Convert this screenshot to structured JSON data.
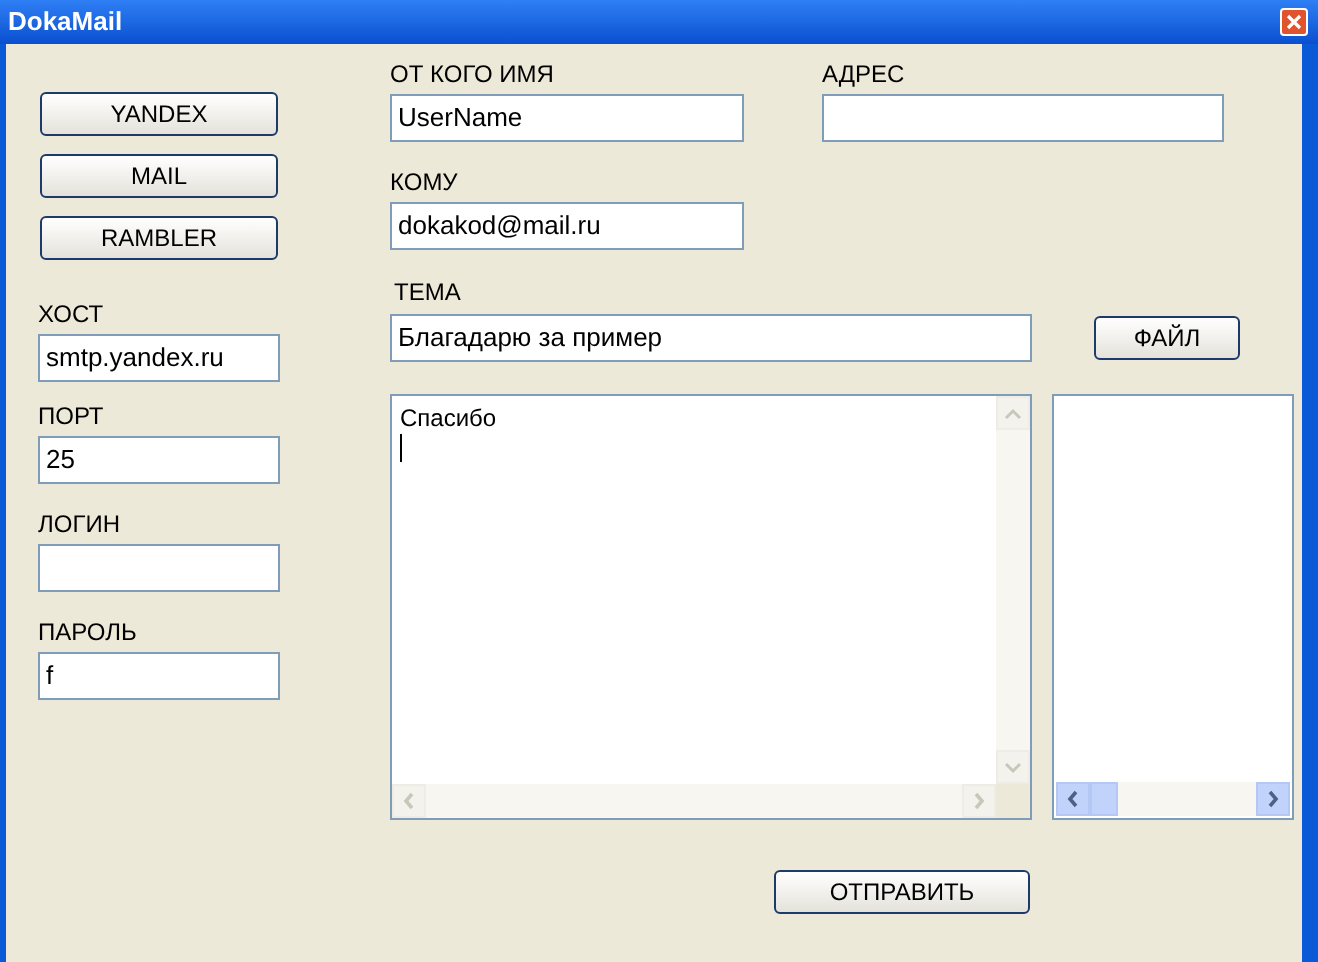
{
  "window": {
    "title": "DokaMail"
  },
  "provider_buttons": [
    "YANDEX",
    "MAIL",
    "RAMBLER"
  ],
  "server_fields": [
    {
      "label": "ХОСТ",
      "value": "smtp.yandex.ru"
    },
    {
      "label": "ПОРТ",
      "value": "25"
    },
    {
      "label": "ЛОГИН"
    },
    {
      "label": "ПАРОЛЬ",
      "value": "f"
    }
  ],
  "from_name": {
    "label": "ОТ КОГО ИМЯ",
    "value": "UserName"
  },
  "address": {
    "label": "АДРЕС"
  },
  "to": {
    "label": "КОМУ",
    "value": "dokakod@mail.ru"
  },
  "subject": {
    "label": "ТЕМА",
    "value": "Благадарю за пример"
  },
  "file_button": "ФАЙЛ",
  "message": {
    "value": "Спасибо"
  },
  "send_button": "ОТПРАВИТЬ"
}
